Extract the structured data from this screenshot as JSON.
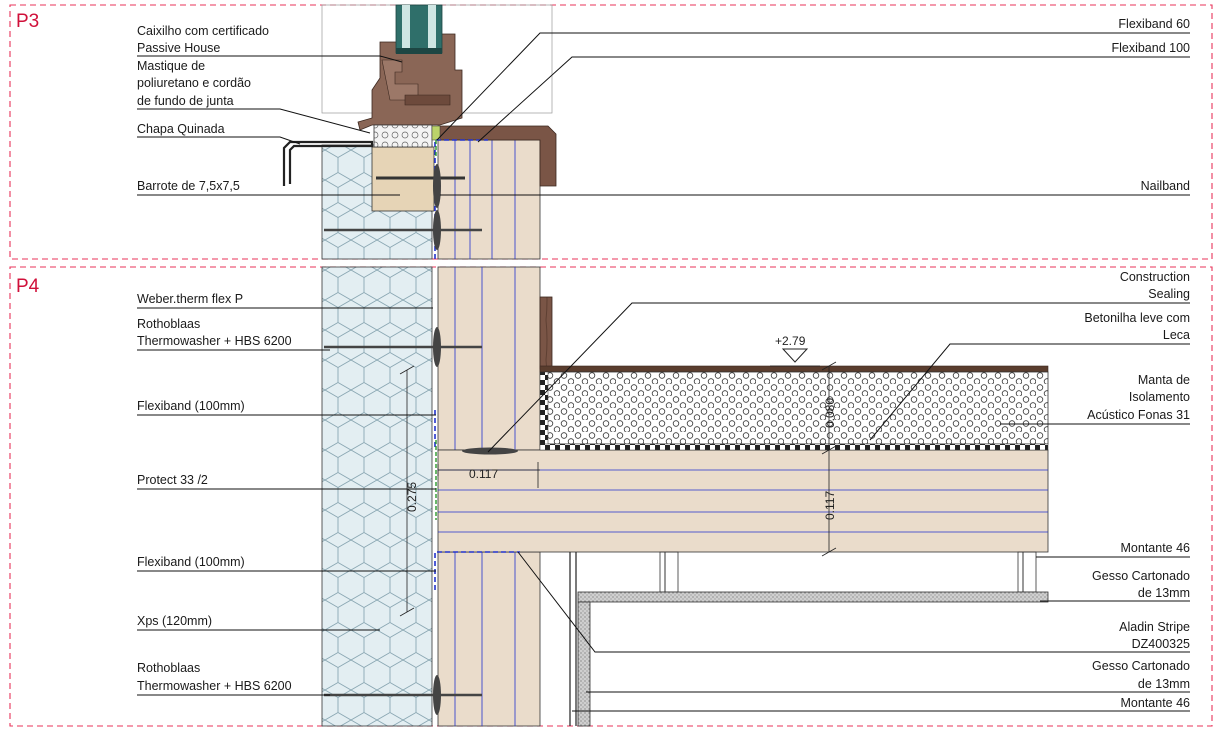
{
  "panels": {
    "p3": "P3",
    "p4": "P4"
  },
  "labels_p3_left": {
    "l1a": "Caixilho com certificado",
    "l1b": "Passive House",
    "l2a": "Mastique de",
    "l2b": "poliuretano e cordão",
    "l2c": "de fundo de junta",
    "l3": "Chapa Quinada",
    "l4": "Barrote de 7,5x7,5"
  },
  "labels_p3_right": {
    "r1": "Flexiband 60",
    "r2": "Flexiband 100",
    "r3": "Nailband"
  },
  "labels_p4_left": {
    "l1": "Weber.therm flex P",
    "l2a": "Rothoblaas",
    "l2b": "Thermowasher + HBS 6200",
    "l3": "Flexiband (100mm)",
    "l4": "Protect 33 /2",
    "l5": "Flexiband (100mm)",
    "l6": "Xps (120mm)",
    "l7a": "Rothoblaas",
    "l7b": "Thermowasher + HBS 6200"
  },
  "labels_p4_right": {
    "r1a": "Construction",
    "r1b": "Sealing",
    "r2a": "Betonilha leve com",
    "r2b": "Leca",
    "r3a": "Manta de",
    "r3b": "Isolamento",
    "r3c": "Acústico Fonas 31",
    "r4": "Montante 46",
    "r5a": "Gesso Cartonado",
    "r5b": "de 13mm",
    "r6a": "Aladin Stripe",
    "r6b": "DZ400325",
    "r7a": "Gesso Cartonado",
    "r7b": "de 13mm",
    "r8": "Montante 46"
  },
  "dimensions": {
    "level": "+2.79",
    "d1": "0.117",
    "d2": "0.275",
    "d3": "0.117",
    "d4": "0.080"
  },
  "colors": {
    "panel_border": "#e8335a",
    "panel_label": "#d0103a",
    "timber": "#eadccb",
    "insulation": "#e3eef2",
    "frame_brown": "#7a5546",
    "glazing": "#2f6f6a",
    "membrane": "#2233cc",
    "dark_brown": "#5a3d2e"
  }
}
